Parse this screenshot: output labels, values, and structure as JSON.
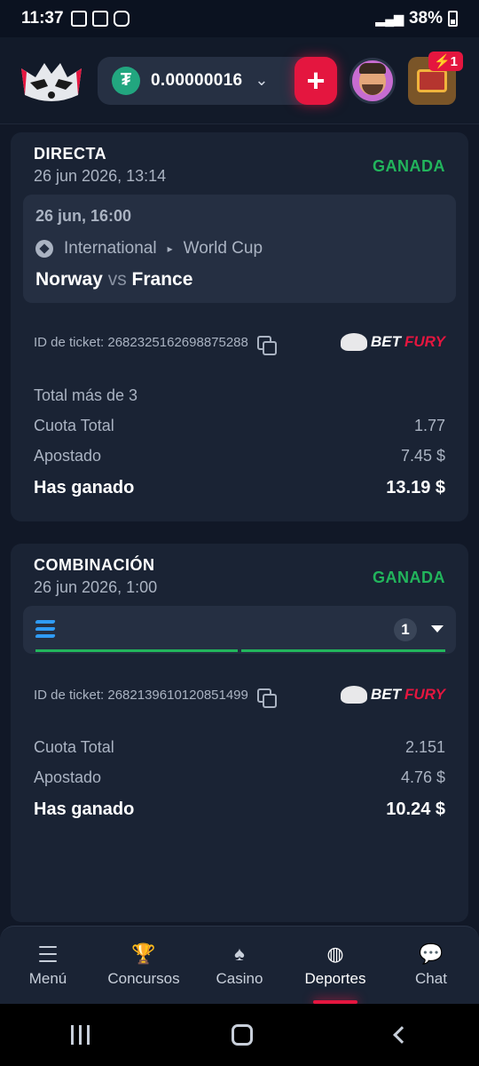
{
  "status_bar": {
    "time": "11:37",
    "battery": "38%"
  },
  "header": {
    "balance": "0.00000016",
    "currency_symbol": "₮",
    "chest_badge": "1"
  },
  "bets": [
    {
      "type": "DIRECTA",
      "date": "26 jun 2026, 13:14",
      "status": "GANADA",
      "match": {
        "date": "26 jun, 16:00",
        "league": "International",
        "competition": "World Cup",
        "home": "Norway",
        "vs": "vs",
        "away": "France"
      },
      "ticket_label": "ID de ticket: 2682325162698875288",
      "market": "Total más de 3",
      "odds_label": "Cuota Total",
      "odds": "1.77",
      "stake_label": "Apostado",
      "stake": "7.45 $",
      "win_label": "Has ganado",
      "win": "13.19 $"
    },
    {
      "type": "COMBINACIÓN",
      "date": "26 jun 2026, 1:00",
      "status": "GANADA",
      "selections_count": "1",
      "ticket_label": "ID de ticket: 2682139610120851499",
      "odds_label": "Cuota Total",
      "odds": "2.151",
      "stake_label": "Apostado",
      "stake": "4.76 $",
      "win_label": "Has ganado",
      "win": "10.24 $"
    }
  ],
  "brand": {
    "bet": "BET",
    "fury": "FURY"
  },
  "nav": [
    {
      "label": "Menú",
      "icon": "menu-icon"
    },
    {
      "label": "Concursos",
      "icon": "trophy-icon"
    },
    {
      "label": "Casino",
      "icon": "spade-icon"
    },
    {
      "label": "Deportes",
      "icon": "basketball-icon",
      "active": true
    },
    {
      "label": "Chat",
      "icon": "chat-icon"
    }
  ],
  "colors": {
    "accent": "#e4163f",
    "win": "#22b55c",
    "card": "#1a2334"
  }
}
